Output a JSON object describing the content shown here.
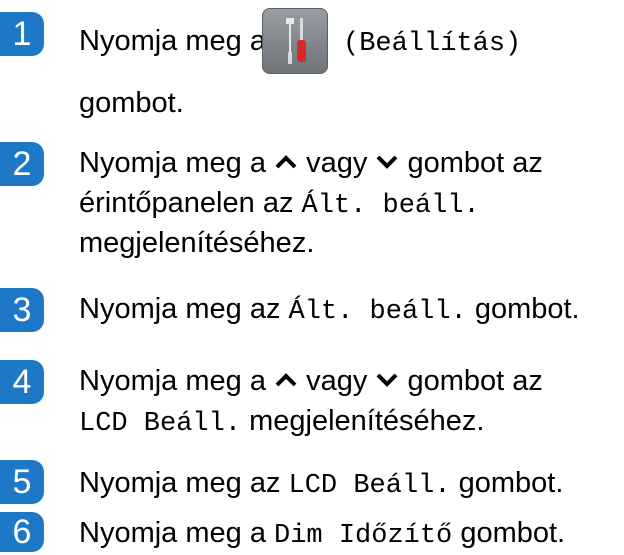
{
  "steps": [
    {
      "number": "1",
      "pre": "Nyomja meg a",
      "icon": "wrench-screwdriver-icon",
      "code": "(Beállítás)",
      "line2": "gombot."
    },
    {
      "number": "2",
      "pre": "Nyomja meg a",
      "mid": "vagy",
      "post": "gombot az",
      "line2_pre": "érintőpanelen az",
      "line2_code": "Ált. beáll.",
      "line3": "megjelenítéséhez."
    },
    {
      "number": "3",
      "pre": "Nyomja meg az",
      "code": "Ált. beáll.",
      "post": "gombot."
    },
    {
      "number": "4",
      "pre": "Nyomja meg a",
      "mid": "vagy",
      "post": "gombot az",
      "line2_code": "LCD Beáll.",
      "line2_post": "megjelenítéséhez."
    },
    {
      "number": "5",
      "pre": "Nyomja meg az",
      "code": "LCD Beáll.",
      "post": "gombot."
    },
    {
      "number": "6",
      "pre": "Nyomja meg a",
      "code": "Dim Időzítő",
      "post": "gombot."
    }
  ],
  "colors": {
    "badge": "#1e78c8"
  }
}
